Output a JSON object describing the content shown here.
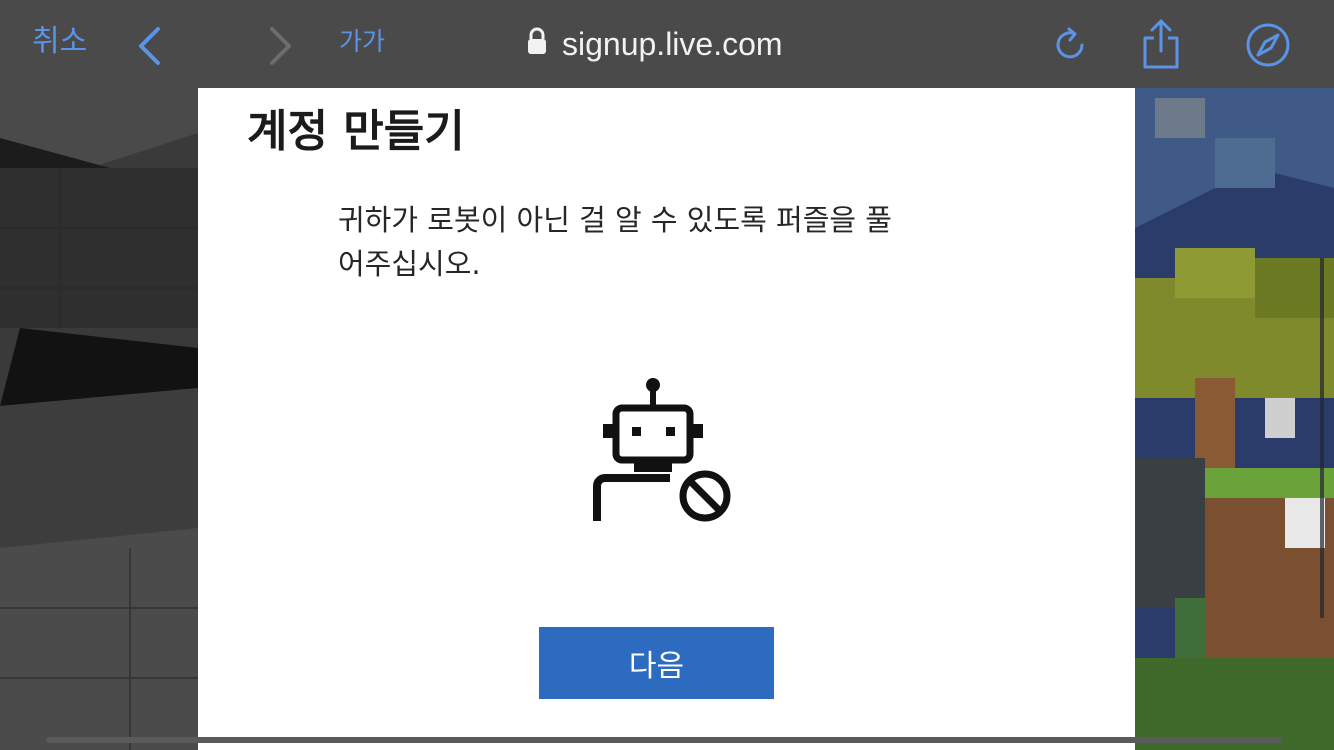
{
  "toolbar": {
    "cancel_label": "취소",
    "text_size_label": "가가",
    "url": "signup.live.com"
  },
  "icons": {
    "back": "chevron-left",
    "forward": "chevron-right",
    "lock": "lock",
    "reload": "reload",
    "share": "share",
    "compass": "compass"
  },
  "colors": {
    "toolbar_bg": "#4a4a4a",
    "toolbar_accent": "#5a93e8",
    "button_bg": "#2c6bbf",
    "card_bg": "#ffffff"
  },
  "dialog": {
    "title": "계정 만들기",
    "description": "귀하가 로봇이 아닌 걸 알 수 있도록 퍼즐을 풀어주십시오.",
    "next_button": "다음"
  }
}
